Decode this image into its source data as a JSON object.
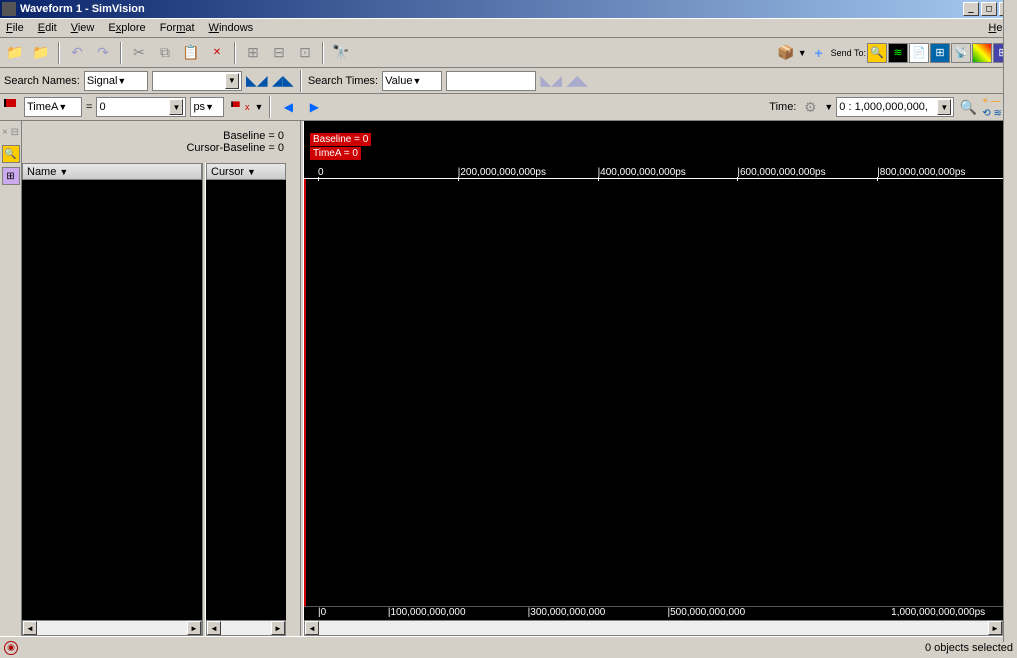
{
  "title": "Waveform 1 - SimVision",
  "menus": [
    "File",
    "Edit",
    "View",
    "Explore",
    "Format",
    "Windows",
    "Help"
  ],
  "search_names_label": "Search Names:",
  "search_names_mode": "Signal",
  "search_times_label": "Search Times:",
  "search_times_mode": "Value",
  "cursor_name": "TimeA",
  "cursor_value": "0",
  "cursor_unit": "ps",
  "time_label": "Time:",
  "time_range": "0 : 1,000,000,000,",
  "baseline_label": "Baseline = 0",
  "cursor_baseline_label": "Cursor-Baseline = 0",
  "name_col": "Name",
  "cursor_col": "Cursor",
  "badge_baseline": "Baseline = 0",
  "badge_timea": "TimeA = 0",
  "top_ticks": [
    {
      "pos": "2%",
      "label": "0"
    },
    {
      "pos": "22%",
      "label": "|200,000,000,000ps"
    },
    {
      "pos": "42%",
      "label": "|400,000,000,000ps"
    },
    {
      "pos": "62%",
      "label": "|600,000,000,000ps"
    },
    {
      "pos": "82%",
      "label": "|800,000,000,000ps"
    }
  ],
  "bottom_ticks": [
    {
      "pos": "2%",
      "label": "|0"
    },
    {
      "pos": "12%",
      "label": "|100,000,000,000"
    },
    {
      "pos": "32%",
      "label": "|300,000,000,000"
    },
    {
      "pos": "52%",
      "label": "|500,000,000,000"
    },
    {
      "pos": "84%",
      "label": "1,000,000,000,000ps"
    }
  ],
  "sendto_label": "Send To:",
  "status_selected": "0 objects selected"
}
